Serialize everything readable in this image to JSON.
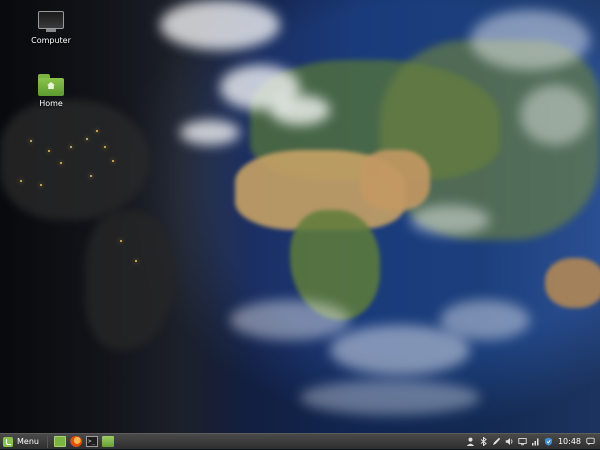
{
  "desktop": {
    "icons": [
      {
        "label": "Computer",
        "icon": "monitor-icon"
      },
      {
        "label": "Home",
        "icon": "home-folder-icon"
      }
    ]
  },
  "taskbar": {
    "menu_label": "Menu",
    "launchers": [
      {
        "icon": "show-desktop-icon"
      },
      {
        "icon": "firefox-icon"
      },
      {
        "icon": "terminal-icon"
      },
      {
        "icon": "files-icon"
      }
    ],
    "tray": [
      {
        "icon": "user-icon"
      },
      {
        "icon": "bluetooth-icon"
      },
      {
        "icon": "pen-icon"
      },
      {
        "icon": "volume-icon"
      },
      {
        "icon": "display-icon"
      },
      {
        "icon": "network-icon"
      },
      {
        "icon": "shield-icon"
      }
    ],
    "clock": "10:48",
    "notification_icon": "notifications-icon"
  },
  "colors": {
    "accent": "#8bc34a",
    "taskbar": "#3a3a3a"
  }
}
